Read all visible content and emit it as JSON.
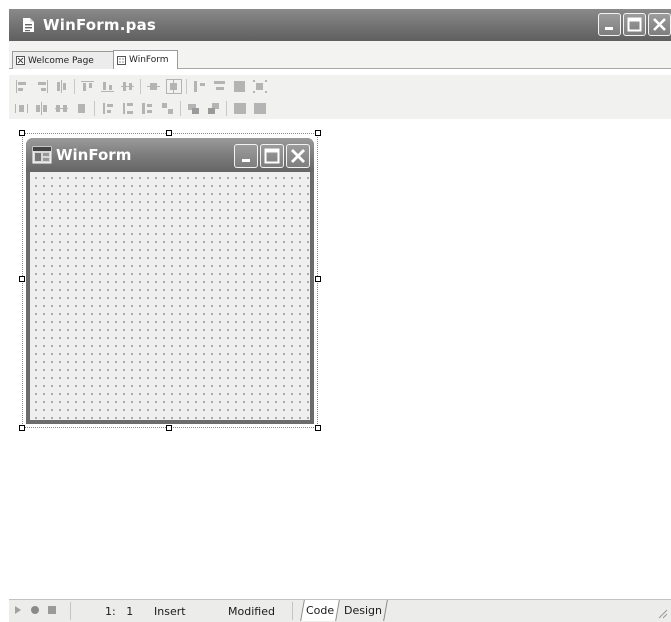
{
  "window": {
    "title": "WinForm.pas"
  },
  "tabs": [
    {
      "label": "Welcome Page",
      "active": false,
      "icon": "close-box-icon"
    },
    {
      "label": "WinForm",
      "active": true,
      "icon": "form-grid-icon"
    }
  ],
  "designer": {
    "form_title": "WinForm",
    "form_icon": "application-icon"
  },
  "status": {
    "position": "1:   1",
    "mode": "Insert",
    "modified": "Modified",
    "tabs": [
      "Code",
      "Design"
    ],
    "controls": [
      "play-icon",
      "record-icon",
      "stop-icon"
    ]
  },
  "toolbars": {
    "align_row_icons": [
      "align-left-icon",
      "align-right-icon",
      "align-center-horizontal-icon",
      "align-top-icon",
      "align-bottom-icon",
      "align-middle-vertical-icon",
      "center-horizontal-icon",
      "center-vertical-icon",
      "space-equal-horizontal-icon",
      "space-equal-vertical-icon",
      "same-size-icon",
      "grid-size-icon"
    ],
    "spacing_row_icons": [
      "increase-hspace-icon",
      "decrease-hspace-icon",
      "equal-hspace-icon",
      "remove-hspace-icon",
      "increase-vspace-icon",
      "decrease-vspace-icon",
      "equal-vspace-icon",
      "remove-vspace-icon",
      "bring-to-front-icon",
      "send-to-back-icon",
      "lock-icon",
      "tab-order-icon"
    ]
  },
  "colors": {
    "title_bar": "#767676",
    "status_bg": "#ececea",
    "toolbar_bg": "#f1f1ef"
  }
}
